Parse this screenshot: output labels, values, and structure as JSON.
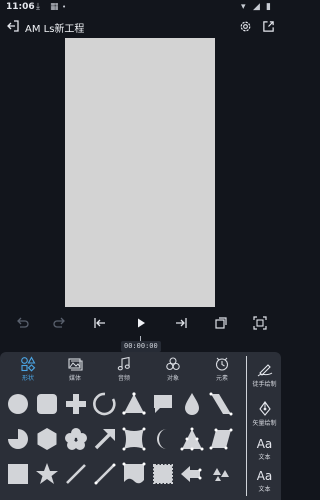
{
  "status": {
    "time": "11:06"
  },
  "app": {
    "title": "AM Ls新工程"
  },
  "timeline": {
    "timecode": "00:00:00"
  },
  "panel": {
    "tabs": [
      {
        "label": "形状"
      },
      {
        "label": "媒体"
      },
      {
        "label": "音频"
      },
      {
        "label": "对象"
      },
      {
        "label": "元素"
      }
    ],
    "side": {
      "freehand": "徒手绘制",
      "vector": "矢量绘制",
      "text1": "文本",
      "text2": "文本",
      "text_glyph": "Aa"
    }
  },
  "colors": {
    "accent": "#4ba6e6",
    "shape": "#d2d4d8",
    "canvas": "#d3d3d3"
  }
}
